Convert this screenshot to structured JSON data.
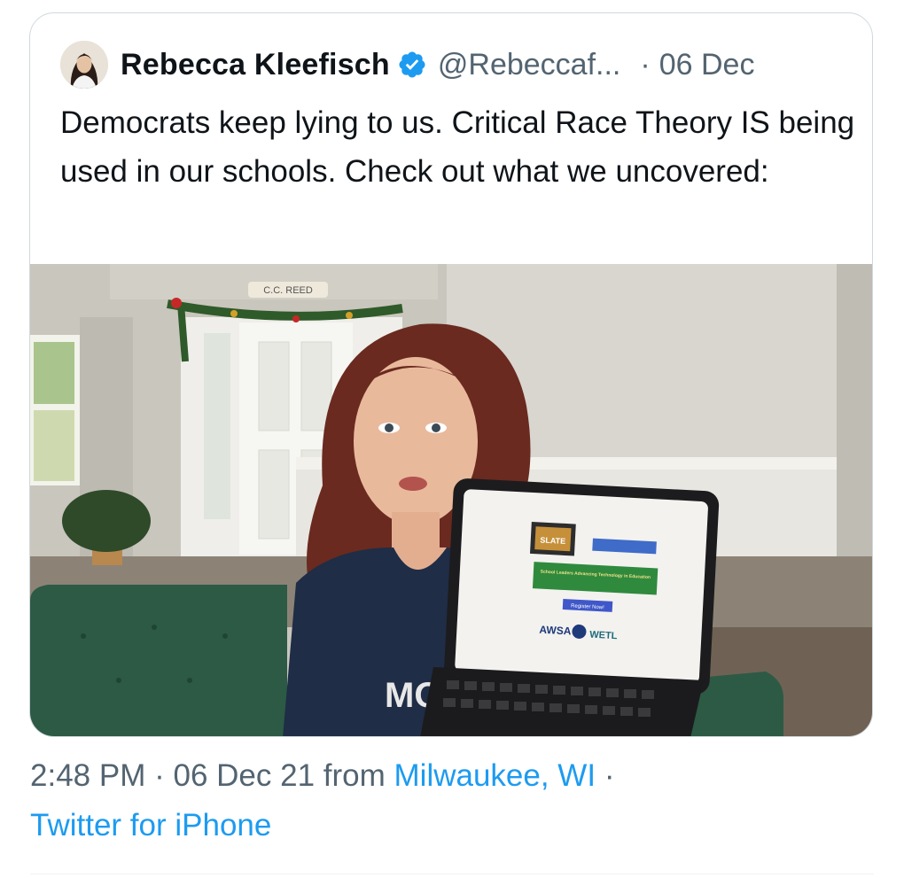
{
  "tweet": {
    "author_name": "Rebecca Kleefisch",
    "author_handle": "@Rebeccaf...",
    "separator": "·",
    "date": "06 Dec",
    "text": "Democrats keep lying to us. Critical Race Theory IS being used in our schools. Check out what we uncovered:",
    "verified": true
  },
  "media": {
    "door_sign": "C.C. REED",
    "shirt_text": "MO",
    "tablet_screen_title": "SLATE",
    "tablet_banner": "School Leaders Advancing Technology in Education",
    "tablet_button": "Register Now!",
    "tablet_logos": [
      "AWSA",
      "WETL"
    ]
  },
  "meta": {
    "time": "2:48 PM",
    "dot": "·",
    "full_date": "06 Dec 21",
    "from_label": "from",
    "location": "Milwaukee, WI",
    "trailing_dot": "·",
    "client": "Twitter for iPhone"
  },
  "colors": {
    "link": "#1d9bf0",
    "secondary_text": "#536471",
    "primary_text": "#0f1419",
    "verified": "#1d9bf0"
  },
  "icons": {
    "verified": "verified-badge-icon"
  }
}
